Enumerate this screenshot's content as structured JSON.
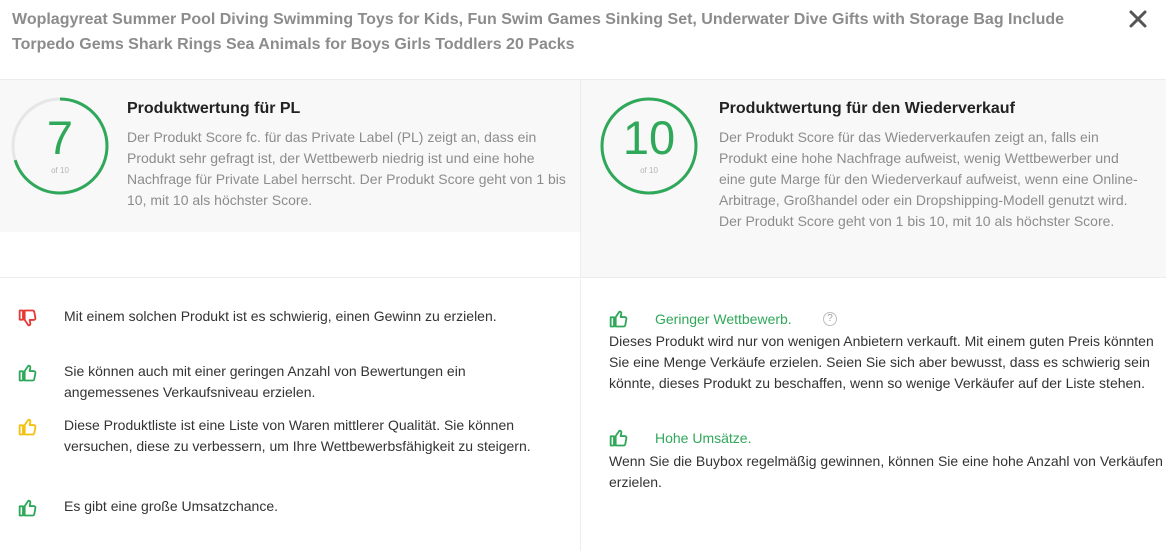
{
  "dialog": {
    "title": "Woplagyreat Summer Pool Diving Swimming Toys for Kids, Fun Swim Games Sinking Set, Underwater Dive Gifts with Storage Bag Include Torpedo Gems Shark Rings Sea Animals for Boys Girls Toddlers 20 Packs",
    "close_icon": "close-icon"
  },
  "pl_score": {
    "value": "7",
    "of_label": "of 10",
    "fraction": 0.7,
    "heading": "Produktwertung für PL",
    "description": "Der Produkt Score fc. für das Private Label (PL) zeigt an, dass ein Produkt sehr gefragt ist, der Wettbewerb niedrig ist und eine hohe Nachfrage für Private Label herrscht. Der Produkt Score geht von 1 bis 10, mit 10 als höchster Score."
  },
  "resale_score": {
    "value": "10",
    "of_label": "of 10",
    "fraction": 1.0,
    "heading": "Produktwertung für den Wiederverkauf",
    "description": "Der Produkt Score für das Wiederverkaufen zeigt an, falls ein Produkt eine hohe Nachfrage aufweist, wenig Wettbewerber und eine gute Marge für den Wiederverkauf aufweist, wenn eine Online-Arbitrage, Großhandel oder ein Dropshipping-Modell genutzt wird. Der Produkt Score geht von 1 bis 10, mit 10 als höchster Score."
  },
  "pl_points": [
    {
      "icon": "thumbs-down-icon",
      "color": "#e53935",
      "text": "Mit einem solchen Produkt ist es schwierig, einen Gewinn zu erzielen."
    },
    {
      "icon": "thumbs-up-icon",
      "color": "#2fa85a",
      "text": "Sie können auch mit einer geringen Anzahl von Bewertungen ein angemessenes Verkaufsniveau erzielen."
    },
    {
      "icon": "thumbs-up-icon",
      "color": "#f4c20d",
      "text": "Diese Produktliste ist eine Liste von Waren mittlerer Qualität. Sie können versuchen, diese zu verbessern, um Ihre Wettbewerbsfähigkeit zu steigern."
    },
    {
      "icon": "thumbs-up-icon",
      "color": "#2fa85a",
      "text": "Es gibt eine große Umsatzchance."
    }
  ],
  "resale_points": [
    {
      "icon": "thumbs-up-icon",
      "color": "#2fa85a",
      "title": "Geringer Wettbewerb.",
      "help": "?",
      "text": "Dieses Produkt wird nur von wenigen Anbietern verkauft. Mit einem guten Preis könnten Sie eine Menge Verkäufe erzielen. Seien Sie sich aber bewusst, dass es schwierig sein könnte, dieses Produkt zu beschaffen, wenn so wenige Verkäufer auf der Liste stehen."
    },
    {
      "icon": "thumbs-up-icon",
      "color": "#2fa85a",
      "title": "Hohe Umsätze.",
      "text": "Wenn Sie die Buybox regelmäßig gewinnen, können Sie eine hohe Anzahl von Verkäufen erzielen."
    }
  ],
  "colors": {
    "accent_green": "#2fa85a",
    "ring_track": "#e6e6e6"
  }
}
